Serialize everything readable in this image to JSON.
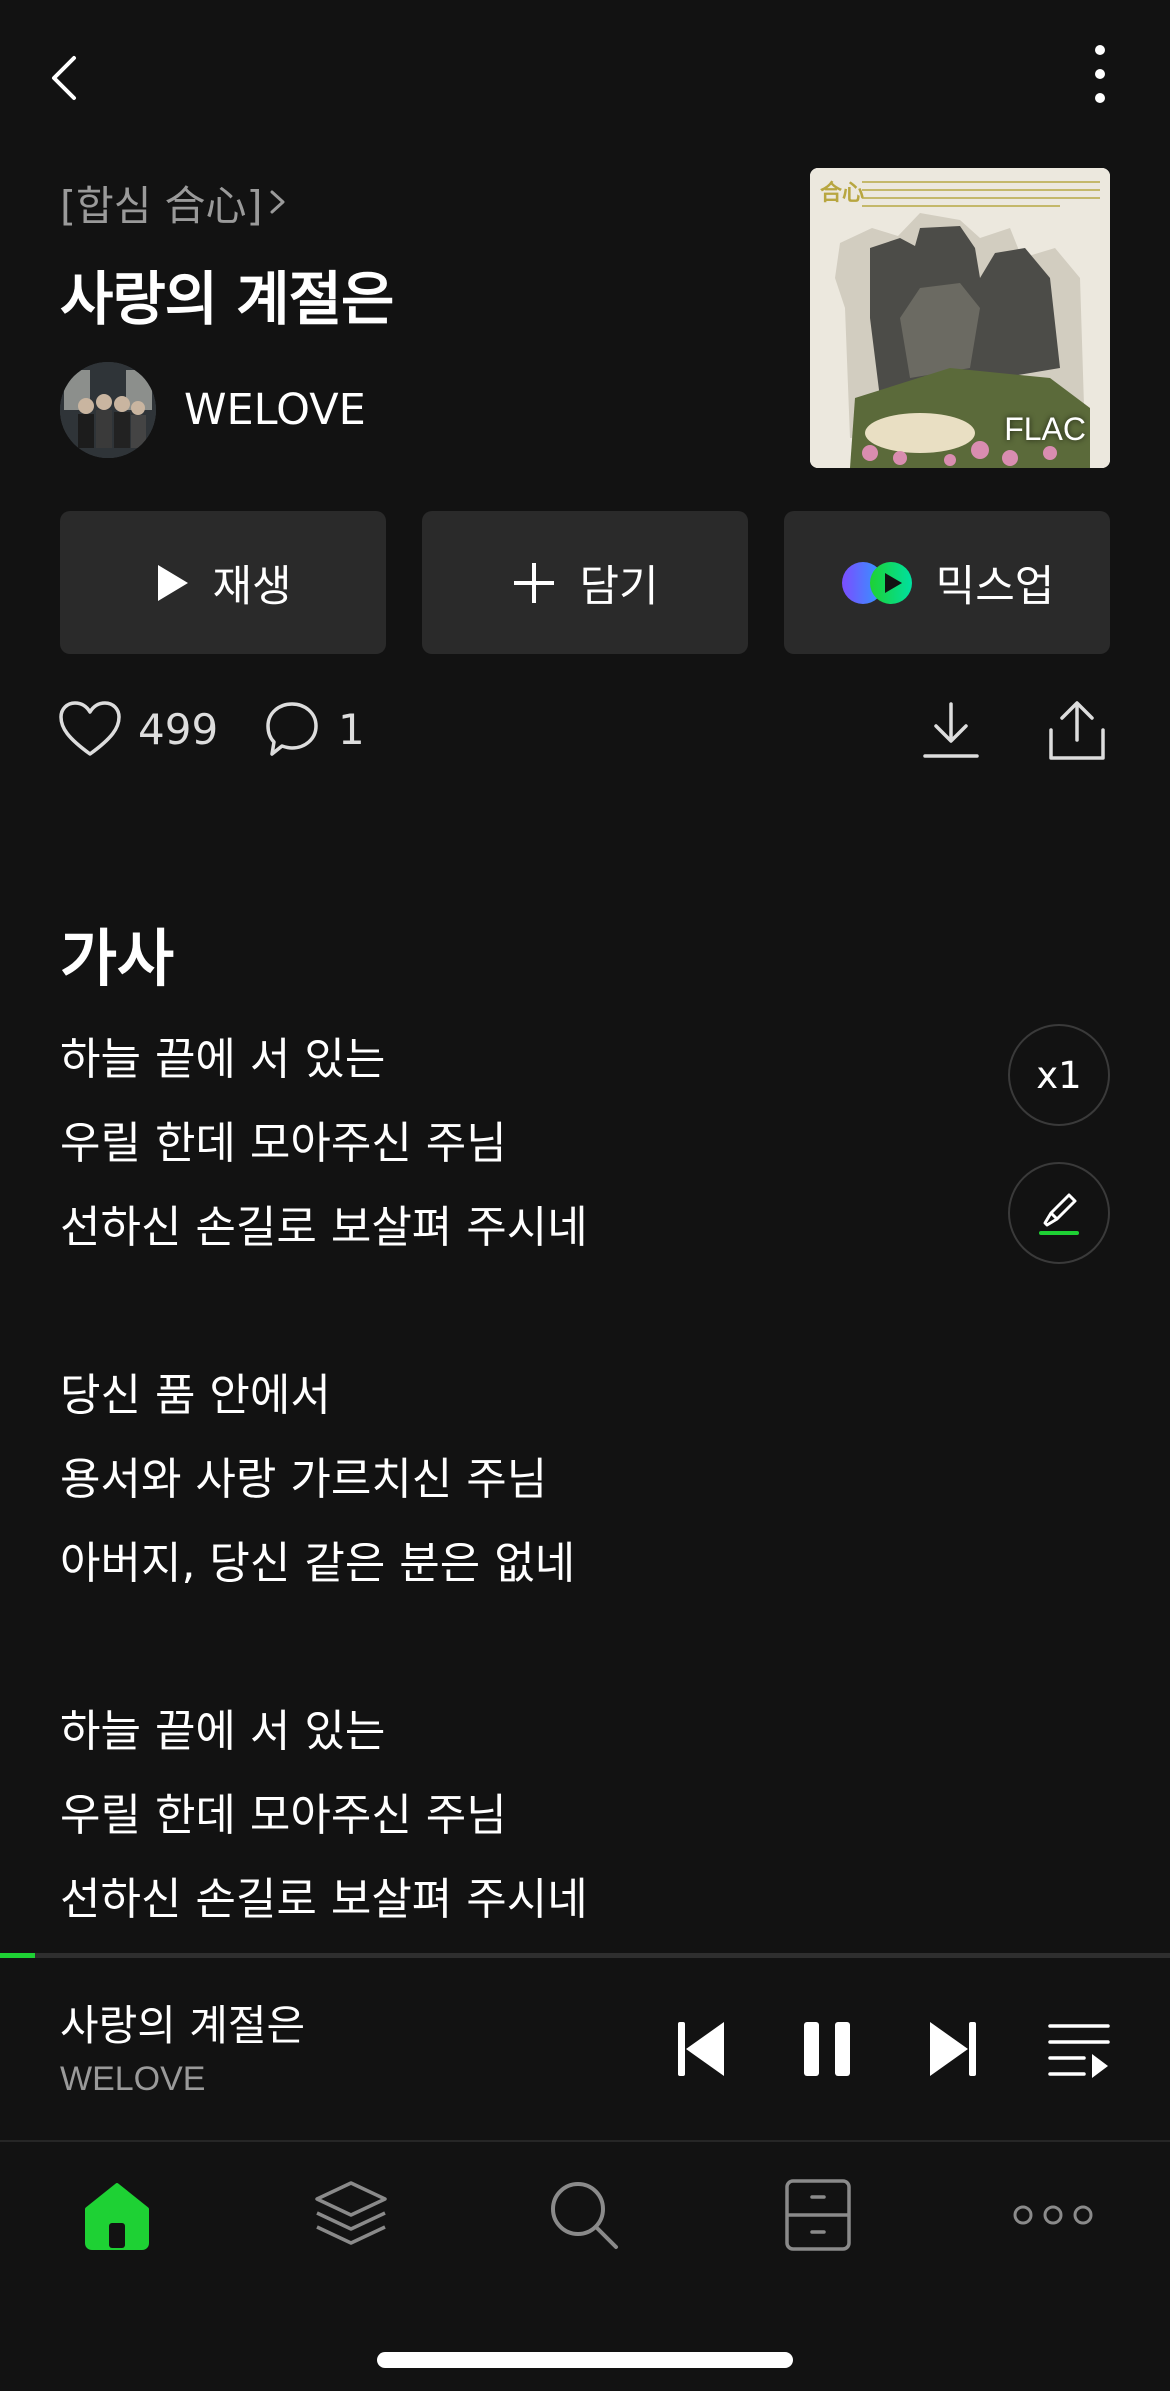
{
  "album": {
    "title": "[합심 合心]"
  },
  "song": {
    "title": "사랑의 계절은",
    "artist": "WELOVE",
    "quality_badge": "FLAC"
  },
  "actions": {
    "play": "재생",
    "add": "담기",
    "mixup": "믹스업"
  },
  "stats": {
    "likes": "499",
    "comments": "1"
  },
  "lyrics": {
    "heading": "가사",
    "lines": [
      "하늘 끝에 서 있는",
      "우릴 한데 모아주신 주님",
      "선하신 손길로 보살펴 주시네",
      "",
      "당신 품 안에서",
      "용서와 사랑 가르치신 주님",
      "아버지, 당신 같은 분은 없네",
      "",
      "하늘 끝에 서 있는",
      "우릴 한데 모아주신 주님",
      "선하신 손길로 보살펴 주시네"
    ],
    "speed_label": "x1"
  },
  "player": {
    "title": "사랑의 계절은",
    "artist": "WELOVE",
    "progress_fraction": 0.03
  },
  "nav": {
    "items": [
      {
        "icon": "home-icon",
        "active": true
      },
      {
        "icon": "layers-icon",
        "active": false
      },
      {
        "icon": "search-icon",
        "active": false
      },
      {
        "icon": "locker-icon",
        "active": false
      },
      {
        "icon": "more-dots-icon",
        "active": false
      }
    ]
  },
  "colors": {
    "background": "#121212",
    "accent": "#1ed134",
    "button_bg": "#2a2a2a",
    "muted_text": "#9a9a9a"
  }
}
